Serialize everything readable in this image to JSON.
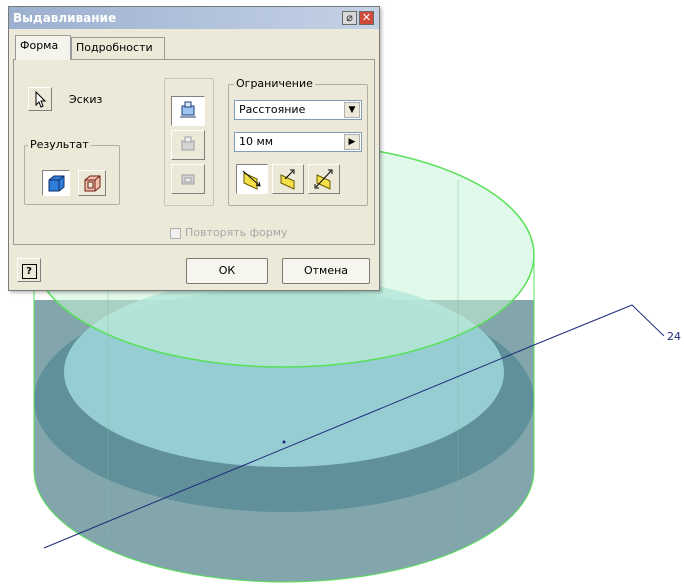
{
  "dialog": {
    "title": "Выдавливание",
    "tabs": [
      {
        "label": "Форма",
        "active": true
      },
      {
        "label": "Подробности",
        "active": false
      }
    ],
    "sketch_label": "Эскиз",
    "result_group": "Результат",
    "limit_group": "Ограничение",
    "extent_select": "Расстояние",
    "distance_value": "10 мм",
    "repeat_shape_label": "Повторять форму",
    "ok_label": "ОК",
    "cancel_label": "Отмена",
    "help_glyph": "?"
  },
  "model": {
    "dimension_label": "24"
  },
  "colors": {
    "edge_green": "#58e058",
    "top_face": "#aef0c8",
    "side_face": "#5b8f99",
    "dimension_line": "#1f2a7a"
  }
}
